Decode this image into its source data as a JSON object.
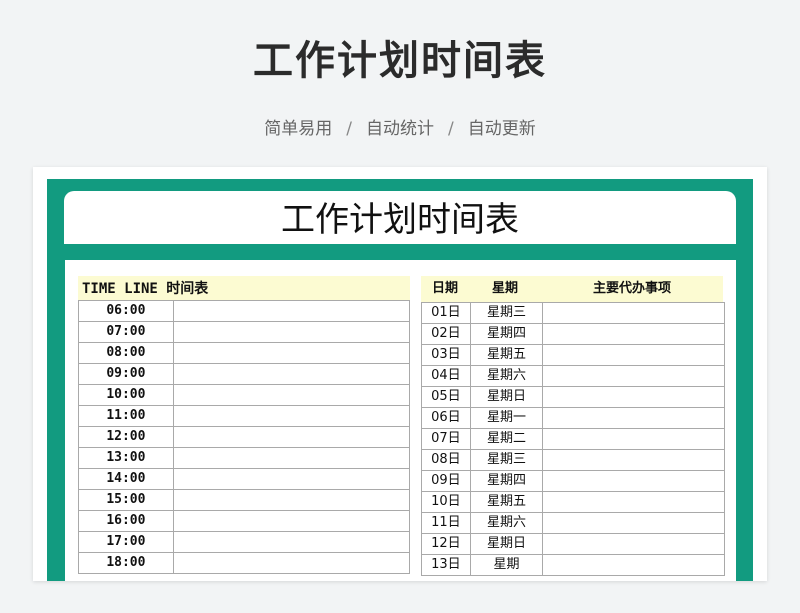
{
  "header": {
    "title": "工作计划时间表",
    "subtitle_items": [
      "简单易用",
      "自动统计",
      "自动更新"
    ],
    "separator": "/"
  },
  "sheet": {
    "banner_title": "工作计划时间表",
    "timeline": {
      "heading": "TIME LINE 时间表",
      "times": [
        "06:00",
        "07:00",
        "08:00",
        "09:00",
        "10:00",
        "11:00",
        "12:00",
        "13:00",
        "14:00",
        "15:00",
        "16:00",
        "17:00",
        "18:00"
      ]
    },
    "calendar": {
      "columns": [
        "日期",
        "星期",
        "主要代办事项"
      ],
      "rows": [
        {
          "date": "01日",
          "weekday": "星期三"
        },
        {
          "date": "02日",
          "weekday": "星期四"
        },
        {
          "date": "03日",
          "weekday": "星期五"
        },
        {
          "date": "04日",
          "weekday": "星期六"
        },
        {
          "date": "05日",
          "weekday": "星期日"
        },
        {
          "date": "06日",
          "weekday": "星期一"
        },
        {
          "date": "07日",
          "weekday": "星期二"
        },
        {
          "date": "08日",
          "weekday": "星期三"
        },
        {
          "date": "09日",
          "weekday": "星期四"
        },
        {
          "date": "10日",
          "weekday": "星期五"
        },
        {
          "date": "11日",
          "weekday": "星期六"
        },
        {
          "date": "12日",
          "weekday": "星期日"
        },
        {
          "date": "13日",
          "weekday": "星期"
        }
      ]
    }
  },
  "colors": {
    "frame": "#129b80",
    "header_fill": "#fcfbd2",
    "grid": "#a9a9a9"
  }
}
